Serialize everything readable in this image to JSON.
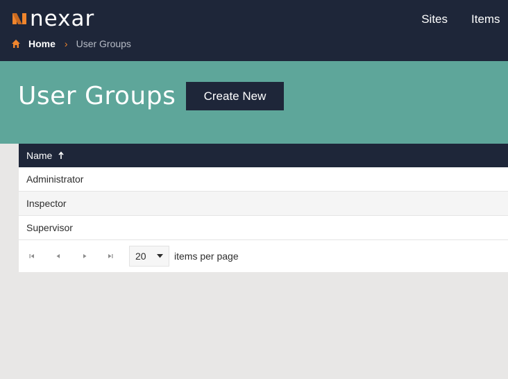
{
  "brand": {
    "name": "nexar",
    "accent_color": "#f0852d",
    "navy": "#1e2639",
    "teal": "#5ea69a"
  },
  "topnav": {
    "items": [
      {
        "label": "Sites"
      },
      {
        "label": "Items"
      }
    ]
  },
  "breadcrumb": {
    "home_label": "Home",
    "current_label": "User Groups",
    "icon": "home-icon"
  },
  "page": {
    "title": "User Groups",
    "create_label": "Create New"
  },
  "grid": {
    "header": {
      "name_label": "Name",
      "sort": "ascending"
    },
    "rows": [
      {
        "name": "Administrator"
      },
      {
        "name": "Inspector"
      },
      {
        "name": "Supervisor"
      }
    ],
    "pager": {
      "page_size": "20",
      "page_size_label": "items per page"
    }
  }
}
